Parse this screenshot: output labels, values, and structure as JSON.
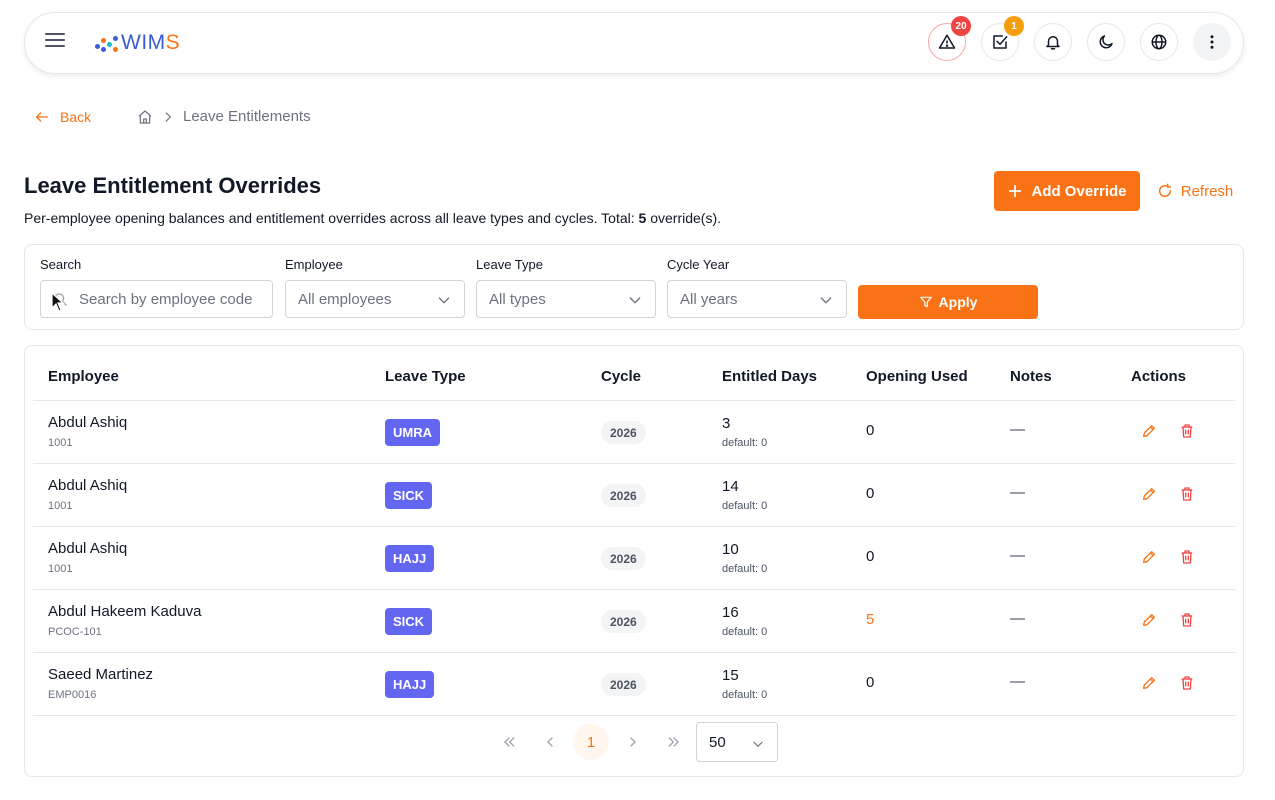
{
  "app": {
    "logo_prefix": "WIM",
    "logo_suffix": "S",
    "alerts_count": "20",
    "tasks_count": "1"
  },
  "nav": {
    "back_label": "Back",
    "breadcrumb_current": "Leave Entitlements"
  },
  "header": {
    "title": "Leave Entitlement Overrides",
    "subtitle_prefix": "Per-employee opening balances and entitlement overrides across all leave types and cycles. Total: ",
    "total": "5",
    "subtitle_suffix": " override(s).",
    "add_label": "Add Override",
    "refresh_label": "Refresh"
  },
  "filters": {
    "search_label": "Search",
    "search_placeholder": "Search by employee code",
    "employee_label": "Employee",
    "employee_value": "All employees",
    "leave_type_label": "Leave Type",
    "leave_type_value": "All types",
    "cycle_label": "Cycle Year",
    "cycle_value": "All years",
    "apply_label": "Apply"
  },
  "table": {
    "columns": {
      "employee": "Employee",
      "leave_type": "Leave Type",
      "cycle": "Cycle",
      "entitled": "Entitled Days",
      "opening": "Opening Used",
      "notes": "Notes",
      "actions": "Actions"
    },
    "rows": [
      {
        "name": "Abdul Ashiq",
        "code": "1001",
        "leave_type": "UMRA",
        "cycle": "2026",
        "entitled": "3",
        "default": "default: 0",
        "opening": "0",
        "notes": "—"
      },
      {
        "name": "Abdul Ashiq",
        "code": "1001",
        "leave_type": "SICK",
        "cycle": "2026",
        "entitled": "14",
        "default": "default: 0",
        "opening": "0",
        "notes": "—"
      },
      {
        "name": "Abdul Ashiq",
        "code": "1001",
        "leave_type": "HAJJ",
        "cycle": "2026",
        "entitled": "10",
        "default": "default: 0",
        "opening": "0",
        "notes": "—"
      },
      {
        "name": "Abdul Hakeem Kaduva",
        "code": "PCOC-101",
        "leave_type": "SICK",
        "cycle": "2026",
        "entitled": "16",
        "default": "default: 0",
        "opening": "5",
        "notes": "—"
      },
      {
        "name": "Saeed Martinez",
        "code": "EMP0016",
        "leave_type": "HAJJ",
        "cycle": "2026",
        "entitled": "15",
        "default": "default: 0",
        "opening": "0",
        "notes": "—"
      }
    ]
  },
  "pagination": {
    "current_page": "1",
    "per_page": "50"
  },
  "colors": {
    "accent": "#f97316",
    "badge": "#6366f1",
    "danger": "#ef4444"
  }
}
